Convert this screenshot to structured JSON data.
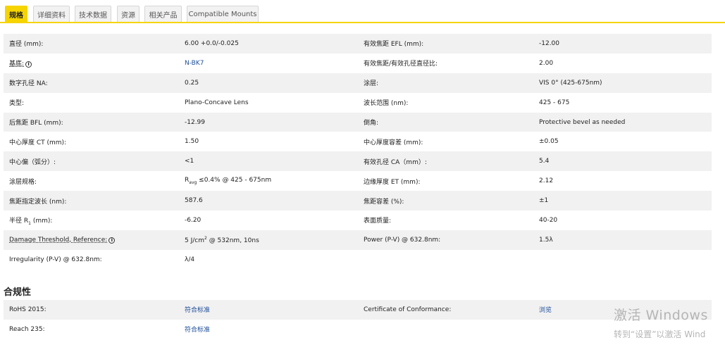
{
  "tabs": [
    {
      "label": "规格",
      "active": true
    },
    {
      "label": "详细资料",
      "active": false
    },
    {
      "label": "技术数据",
      "active": false
    },
    {
      "label": "资源",
      "active": false
    },
    {
      "label": "相关产品",
      "active": false
    },
    {
      "label": "Compatible Mounts",
      "active": false
    }
  ],
  "specs": [
    {
      "l1": "直径 (mm):",
      "v1": "6.00 +0.0/-0.025",
      "l2": "有效焦距 EFL (mm):",
      "v2": "-12.00"
    },
    {
      "l1": "基底:",
      "v1": "N-BK7",
      "l2": "有效焦距/有效孔径直径比:",
      "v2": "2.00"
    },
    {
      "l1": "数字孔径 NA:",
      "v1": "0.25",
      "l2": "涂层:",
      "v2": "VIS 0° (425-675nm)"
    },
    {
      "l1": "类型:",
      "v1": "Plano-Concave Lens",
      "l2": "波长范围 (nm):",
      "v2": "425 - 675"
    },
    {
      "l1": "后焦距 BFL (mm):",
      "v1": "-12.99",
      "l2": "倒角:",
      "v2": "Protective bevel as needed"
    },
    {
      "l1": "中心厚度 CT (mm):",
      "v1": "1.50",
      "l2": "中心厚度容差 (mm):",
      "v2": "±0.05"
    },
    {
      "l1": "中心偏（弧分）:",
      "v1": "<1",
      "l2": "有效孔径 CA（mm）:",
      "v2": "5.4"
    },
    {
      "l1": "涂层规格:",
      "v1_pre": "R",
      "v1_sub": "avg",
      "v1_post": " ≤0.4% @ 425 - 675nm",
      "l2": "边缘厚度 ET (mm):",
      "v2": "2.12"
    },
    {
      "l1": "焦距指定波长 (nm):",
      "v1": "587.6",
      "l2": "焦距容差 (%):",
      "v2": "±1"
    },
    {
      "l1_pre": "半径 R",
      "l1_sub": "1",
      "l1_post": " (mm):",
      "v1": "-6.20",
      "l2": "表面质量:",
      "v2": "40-20"
    },
    {
      "l1": "Damage Threshold, Reference:",
      "v1_pre": "5 J/cm",
      "v1_sup": "2",
      "v1_post": " @ 532nm, 10ns",
      "l2": "Power (P-V) @ 632.8nm:",
      "v2": "1.5λ"
    },
    {
      "l1": "Irregularity (P-V) @ 632.8nm:",
      "v1": "λ/4",
      "l2": "",
      "v2": ""
    }
  ],
  "compliance": {
    "title": "合规性",
    "rows": [
      {
        "l1": "RoHS 2015:",
        "v1": "符合标准",
        "l2": "Certificate of Conformance:",
        "v2": "浏览"
      },
      {
        "l1": "Reach 235:",
        "v1": "符合标准",
        "l2": "",
        "v2": ""
      }
    ]
  },
  "info_icon_glyph": "i",
  "watermark": {
    "line1": "激活 Windows",
    "line2": "转到“设置”以激活 Wind"
  },
  "colors": {
    "accent": "#f5d400",
    "link": "#1f4e9a",
    "row_shade": "#f1f1f1"
  }
}
